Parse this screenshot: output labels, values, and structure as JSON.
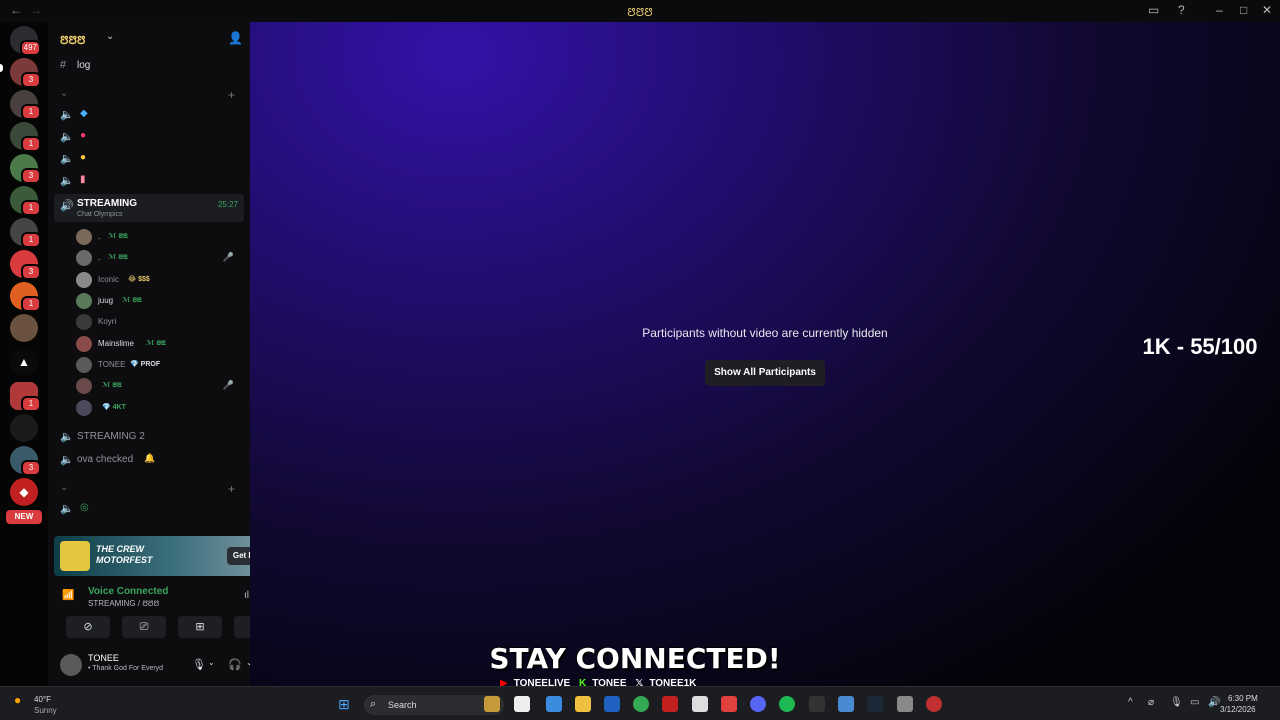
{
  "window": {
    "title": "ꢅꢅꢅ",
    "back": "←",
    "forward": "→"
  },
  "rail": {
    "home_badge": "497",
    "badges": [
      "3",
      "1",
      "1",
      "3",
      "1",
      "1",
      "3",
      "1",
      "1",
      "3"
    ],
    "new_label": "NEW"
  },
  "server": {
    "name": "ꢅꢅꢅ",
    "channels": {
      "log": "log",
      "streaming": "STREAMING",
      "streaming_sub": "Chat Olympics",
      "streaming_time": "25:27",
      "streaming2": "STREAMING 2",
      "ova": "ova checked"
    }
  },
  "members": [
    {
      "name": ".",
      "tag": "ℳ ꢂꢃ"
    },
    {
      "name": ".",
      "tag": "ℳ ꢂꢃ"
    },
    {
      "name": "Iconic",
      "tag": "😂 $$$"
    },
    {
      "name": "juug",
      "tag": "ℳ ꢂꢃ"
    },
    {
      "name": "Koyri",
      "tag": ""
    },
    {
      "name": "Mainslime",
      "tag": "ℳ ꢂꢃ"
    },
    {
      "name": "TONEE",
      "tag": "💎 PROF"
    },
    {
      "name": "",
      "tag": "ℳ ꢂꢃ"
    },
    {
      "name": "",
      "tag": "💎 4KT"
    }
  ],
  "promo": {
    "brand": "THE CREW MOTORFEST",
    "button": "Get Reward!"
  },
  "voice": {
    "status": "Voice Connected",
    "channel": "STREAMING / ꢅꢅꢅ"
  },
  "user": {
    "name": "TONEE",
    "status": "• Thank God For Everyd"
  },
  "main": {
    "hidden_text": "Participants without video are currently hidden",
    "show_all": "Show All Participants",
    "counter": "1K - 55/100"
  },
  "overlay": {
    "title": "STAY CONNECTED!",
    "youtube": "TONEELIVE",
    "kick": "TONEE",
    "x": "TONEE1K"
  },
  "taskbar": {
    "temp": "40°F",
    "condition": "Sunny",
    "search": "Search",
    "time": "6:30 PM",
    "date": "3/12/2026"
  },
  "colors": {
    "accent_green": "#3ba55d",
    "danger": "#d83c3e",
    "gold": "#e8c96a"
  }
}
